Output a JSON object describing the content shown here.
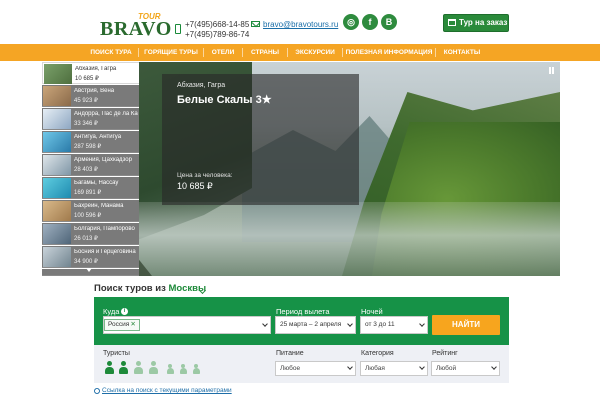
{
  "brand": {
    "logo_text": "BRAVO",
    "logo_sub": "TOUR",
    "colors": {
      "green": "#169247",
      "orange": "#f5a524",
      "dark_green": "#2a8a3a"
    }
  },
  "header": {
    "phones": [
      "+7(495)668-14-85",
      "+7(495)789-86-74"
    ],
    "email": "bravo@bravotours.ru",
    "social_icons": [
      "instagram-icon",
      "facebook-icon",
      "vk-icon"
    ],
    "social_labels": [
      "◎",
      "f",
      "В"
    ],
    "tour_order_label": "Тур на заказ"
  },
  "nav": {
    "items": [
      "Поиск тура",
      "Горящие туры",
      "Отели",
      "Страны",
      "Экскурсии",
      "Полезная информация",
      "Контакты"
    ]
  },
  "hero": {
    "location": "Абхазия, Гагра",
    "title": "Белые Скалы",
    "stars": "3★",
    "price_label": "Цена за человека:",
    "price": "10 685 ₽"
  },
  "destinations": [
    {
      "name": "Абхазия, Гагра",
      "price": "10 685 ₽",
      "active": true
    },
    {
      "name": "Австрия, Вена",
      "price": "45 923 ₽",
      "active": false
    },
    {
      "name": "Андорра, Пас де ла Каса",
      "price": "33 346 ₽",
      "active": false
    },
    {
      "name": "Антигуа, Антигуа",
      "price": "287 598 ₽",
      "active": false
    },
    {
      "name": "Армения, Цахкадзор",
      "price": "28 403 ₽",
      "active": false
    },
    {
      "name": "Багамы, Нассау",
      "price": "169 891 ₽",
      "active": false
    },
    {
      "name": "Бахрейн, Манама",
      "price": "100 596 ₽",
      "active": false
    },
    {
      "name": "Болгария, Пампорово",
      "price": "26 013 ₽",
      "active": false
    },
    {
      "name": "Босния и Герцеговина",
      "price": "34 900 ₽",
      "active": false
    }
  ],
  "search": {
    "heading_prefix": "Поиск туров из",
    "city": "Москвы",
    "where_label": "Куда",
    "info_icon_text": "i",
    "where_tag": "Россия",
    "tag_remove": "✕",
    "period_label": "Период вылета",
    "period_value": "25 марта – 2 апреля",
    "nights_label": "Ночей",
    "nights_value": "от 3 до 11",
    "find_button": "Найти"
  },
  "filters": {
    "tourists_label": "Туристы",
    "tourists_selected": 2,
    "food_label": "Питание",
    "food_value": "Любое",
    "category_label": "Категория",
    "category_value": "Любая",
    "rating_label": "Рейтинг",
    "rating_value": "Любой"
  },
  "footer_link": "Ссылка на поиск с текущими параметрами"
}
